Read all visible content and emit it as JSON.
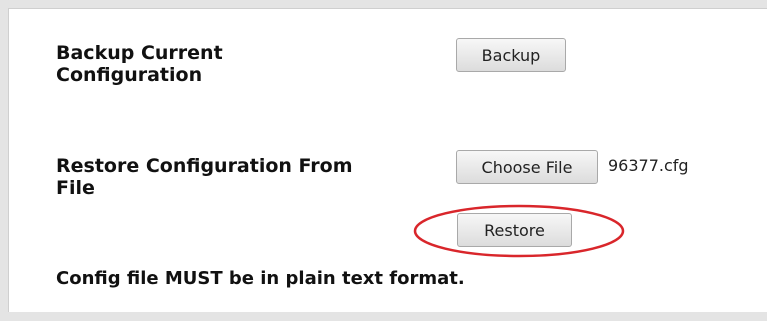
{
  "backup": {
    "label": "Backup Current Configuration",
    "button_label": "Backup"
  },
  "restore": {
    "label": "Restore Configuration From File",
    "choose_file_label": "Choose File",
    "selected_file": "96377.cfg",
    "restore_button_label": "Restore"
  },
  "note": "Config file MUST be in plain text format.",
  "annotation": {
    "highlight_color": "#d9262b",
    "highlight_shape": "ellipse around Restore button"
  },
  "colors": {
    "frame": "#e4e4e4",
    "text": "#111111"
  }
}
